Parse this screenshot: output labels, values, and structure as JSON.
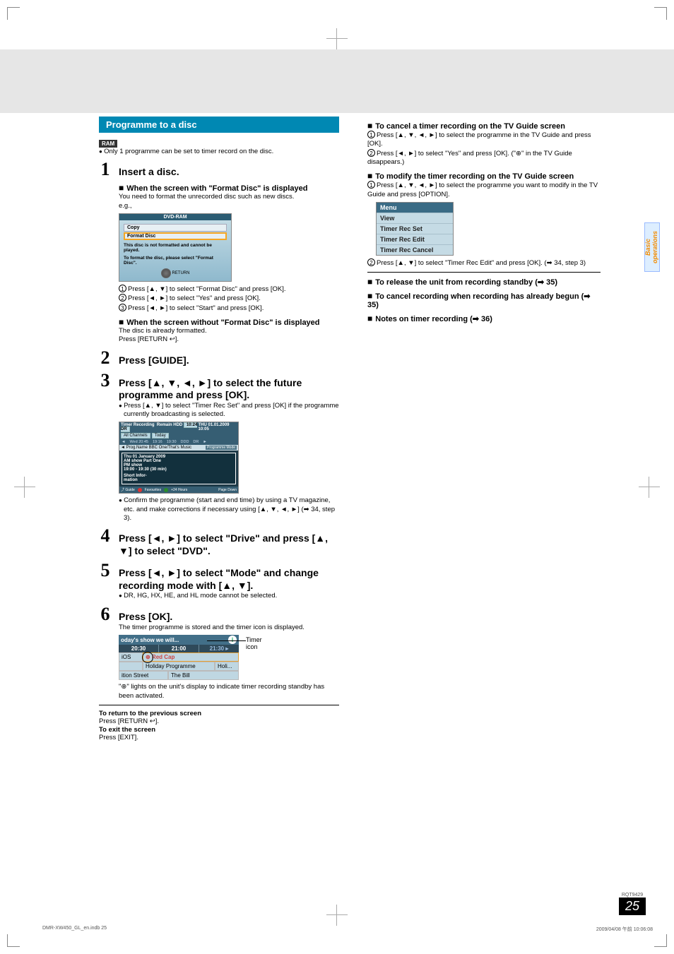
{
  "section_title": "Programme to a disc",
  "ram_label": "RAM",
  "ram_note": "Only 1 programme can be set to timer record on the disc.",
  "step1": {
    "num": "1",
    "title": "Insert a disc.",
    "sub_a_title": "When the screen with \"Format Disc\" is displayed",
    "sub_a_body": "You need to format the unrecorded disc such as new discs.",
    "eg": "e.g.,",
    "sub_a_line1": "Press [▲, ▼] to select \"Format Disc\" and press [OK].",
    "sub_a_line2": "Press [◄, ►] to select \"Yes\" and press [OK].",
    "sub_a_line3": "Press [◄, ►] to select \"Start\" and press [OK].",
    "sub_b_title": "When the screen without \"Format Disc\" is displayed",
    "sub_b_body1": "The disc is already formatted.",
    "sub_b_body2": "Press [RETURN ↩]."
  },
  "format_box": {
    "title": "DVD-RAM",
    "row_copy": "Copy",
    "row_format": "Format Disc",
    "msg1": "This disc is not formatted and cannot be played.",
    "msg2": "To format the disc, please select \"Format Disc\".",
    "return_label": "RETURN"
  },
  "step2": {
    "num": "2",
    "title": "Press [GUIDE]."
  },
  "step3": {
    "num": "3",
    "title": "Press [▲, ▼, ◄, ►] to select the future programme and press [OK].",
    "bullet1": "Press [▲, ▼] to select \"Timer Rec Set\" and press [OK] if the programme currently broadcasting is selected.",
    "bullet2": "Confirm the programme (start and end time) by using a TV magazine, etc. and make corrections if necessary using [▲, ▼, ◄, ►] (➡ 34, step 3)."
  },
  "guide": {
    "top_left": "Timer Recording",
    "remain": "Remain HDD",
    "remain_val": "10:24 DR",
    "top_right": "THU 01.01.2009 10:05",
    "chip1": "All Channels",
    "chip2": "Today",
    "cols": [
      "",
      "Wed 20:45",
      "19:16",
      "19:30",
      "DDD",
      "DR",
      ""
    ],
    "mid_left": "◄ Prog.Name    BBC One/That's Music",
    "mid_right": "Programme Mode",
    "detail1": "Thu  01 January 2009",
    "detail2": "AM  show Part One",
    "detail3": "PM   show",
    "detail4": "19:00 - 19:30 (30 min)",
    "detail5": "Short Infor-",
    "detail6": "mation",
    "bot_guide": "Guide",
    "bot_favourite": "Favourites",
    "bot_24": "+24 Hours",
    "bot_down": "Page Down"
  },
  "step4": {
    "num": "4",
    "title": "Press [◄, ►] to select \"Drive\" and press [▲, ▼] to select \"DVD\"."
  },
  "step5": {
    "num": "5",
    "title": "Press [◄, ►] to select \"Mode\" and change recording mode with [▲, ▼].",
    "bullet": "DR, HG, HX, HE, and HL mode cannot be selected."
  },
  "step6": {
    "num": "6",
    "title": "Press [OK].",
    "body": "The timer programme is stored and the timer icon is displayed.",
    "after": "\"⊕\" lights on the unit's display to indicate timer recording standby has been activated."
  },
  "tv_strip": {
    "headline": "oday's show we will...",
    "times": [
      "20:30",
      "21:00",
      "21:30 ▸"
    ],
    "row1a": "iOS",
    "row1b": "⊕ Red Cap",
    "row2a": "",
    "row2b": "Holiday Programme",
    "row2c": "Holi...",
    "row3a": "ition Street",
    "row3b": "The Bill",
    "timer_label": "Timer icon"
  },
  "return_block": {
    "t1": "To return to the previous screen",
    "b1": "Press [RETURN ↩].",
    "t2": "To exit the screen",
    "b2": "Press [EXIT]."
  },
  "right": {
    "h1": "To cancel a timer recording on the TV Guide screen",
    "h1_l1": "Press [▲, ▼, ◄, ►] to select the programme in the TV Guide and press [OK].",
    "h1_l2": "Press [◄, ►] to select \"Yes\" and press [OK]. (\"⊕\" in the TV Guide disappears.)",
    "h2": "To modify the timer recording on the TV Guide screen",
    "h2_l1": "Press [▲, ▼, ◄, ►] to select the programme you want to modify in the TV Guide and press [OPTION].",
    "menu": [
      "Menu",
      "View",
      "Timer Rec Set",
      "Timer Rec Edit",
      "Timer Rec Cancel"
    ],
    "h2_l2": "Press [▲, ▼] to select \"Timer Rec Edit\" and press [OK]. (➡ 34, step 3)",
    "h3": "To release the unit from recording standby (➡ 35)",
    "h4": "To cancel recording when recording has already begun (➡ 35)",
    "h5": "Notes on timer recording (➡ 36)"
  },
  "side_tab": "Basic operations",
  "footer": {
    "rqt": "RQT9429",
    "page": "25"
  },
  "footline": {
    "left": "DMR-XW450_GL_en.indb   25",
    "right": "2009/04/08   午前 10:06:08"
  }
}
